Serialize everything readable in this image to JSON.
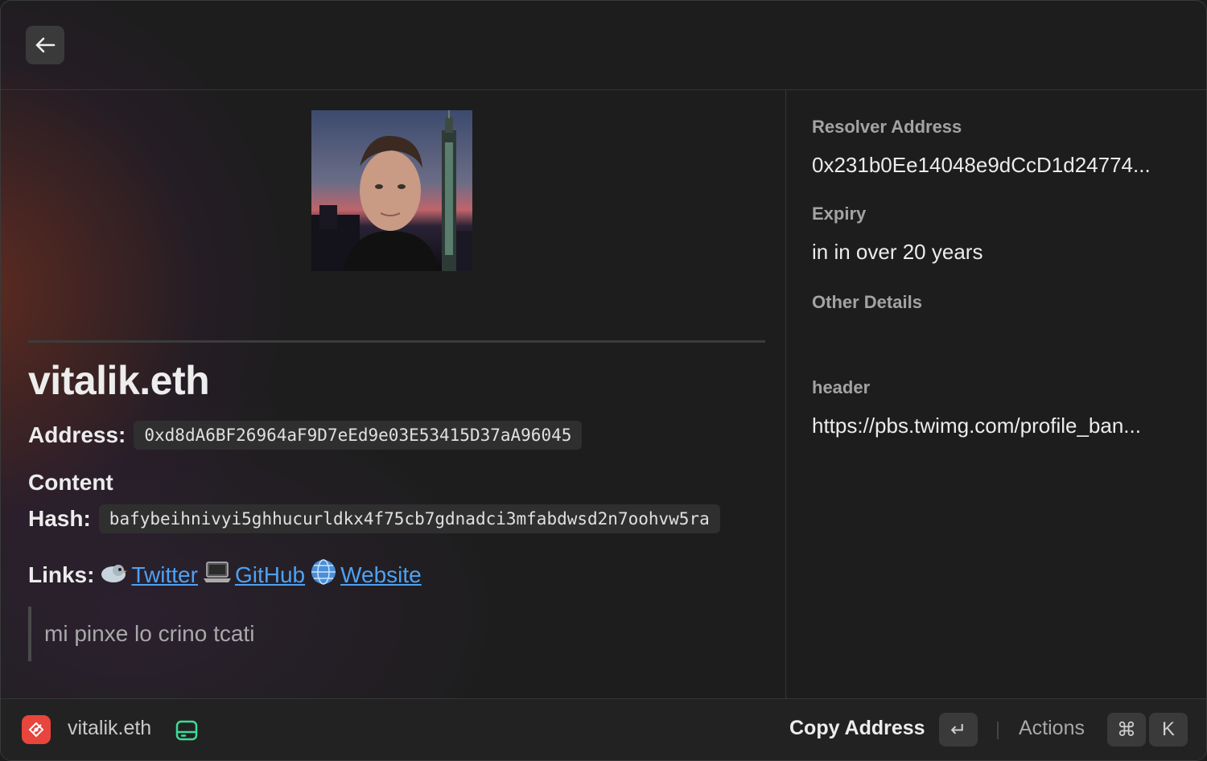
{
  "main": {
    "name": "vitalik.eth",
    "address_label": "Address:",
    "address_value": "0xd8dA6BF26964aF9D7eEd9e03E53415D37aA96045",
    "content_label_line1": "Content",
    "content_label_line2": "Hash:",
    "content_hash": "bafybeihnivyi5ghhucurldkx4f75cb7gdnadci3mfabdwsd2n7oohvw5ra",
    "links_label": "Links:",
    "links": [
      {
        "emoji": "bird-icon",
        "label": "Twitter"
      },
      {
        "emoji": "laptop-icon",
        "label": "GitHub"
      },
      {
        "emoji": "globe-icon",
        "label": "Website"
      }
    ],
    "description": "mi pinxe lo crino tcati"
  },
  "side": {
    "resolver_label": "Resolver Address",
    "resolver_value": "0x231b0Ee14048e9dCcD1d24774...",
    "expiry_label": "Expiry",
    "expiry_value": "in in over 20 years",
    "other_label": "Other Details",
    "header_label": "header",
    "header_value": "https://pbs.twimg.com/profile_ban..."
  },
  "footer": {
    "title": "vitalik.eth",
    "primary_action": "Copy Address",
    "enter_key": "↵",
    "actions_label": "Actions",
    "cmd_key": "⌘",
    "k_key": "K"
  },
  "colors": {
    "link": "#4ea1f3",
    "app_icon": "#e8453c",
    "drive_icon": "#3ddc97"
  }
}
